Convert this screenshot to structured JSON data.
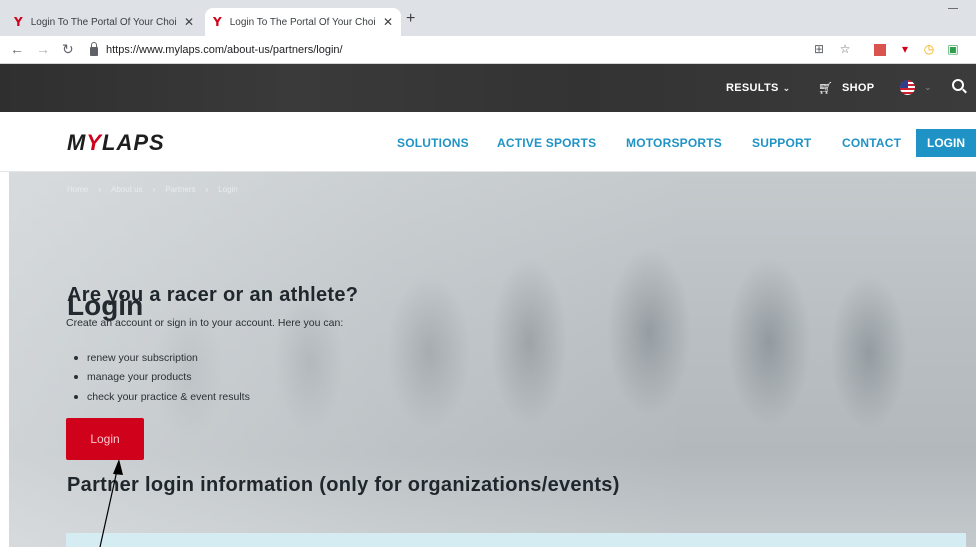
{
  "browser": {
    "tabs": [
      {
        "title": "Login To The Portal Of Your Choi",
        "active": false
      },
      {
        "title": "Login To The Portal Of Your Choi",
        "active": true
      }
    ],
    "new_tab_symbol": "+",
    "url": "https://www.mylaps.com/about-us/partners/login/",
    "nav_icons": [
      "back-arrow-icon",
      "forward-arrow-icon",
      "reload-icon"
    ],
    "extension_icons": [
      "translate-icon",
      "star-icon",
      "pdf-icon",
      "pocket-icon",
      "clock-icon",
      "green-extension-icon"
    ]
  },
  "topbar": {
    "results_label": "RESULTS",
    "shop_label": "SHOP",
    "language": "en-US flag"
  },
  "nav": {
    "logo_prefix": "M",
    "logo_y": "Y",
    "logo_suffix": "LAPS",
    "items": [
      "SOLUTIONS",
      "ACTIVE SPORTS",
      "MOTORSPORTS",
      "SUPPORT",
      "CONTACT"
    ],
    "login_label": "LOGIN",
    "link_color": "#1f93c5"
  },
  "page": {
    "breadcrumb": [
      "Home",
      "About us",
      "Partners",
      "Login"
    ],
    "title": "Login",
    "section_title": "Are you a racer or an athlete?",
    "intro": "Create an account or sign in to your account. Here you can:",
    "bullets": [
      "renew your subscription",
      "manage your products",
      "check your practice & event results"
    ],
    "login_button": "Login",
    "partner_title": "Partner login information (only for organizations/events)",
    "accent_red": "#d0021b"
  }
}
